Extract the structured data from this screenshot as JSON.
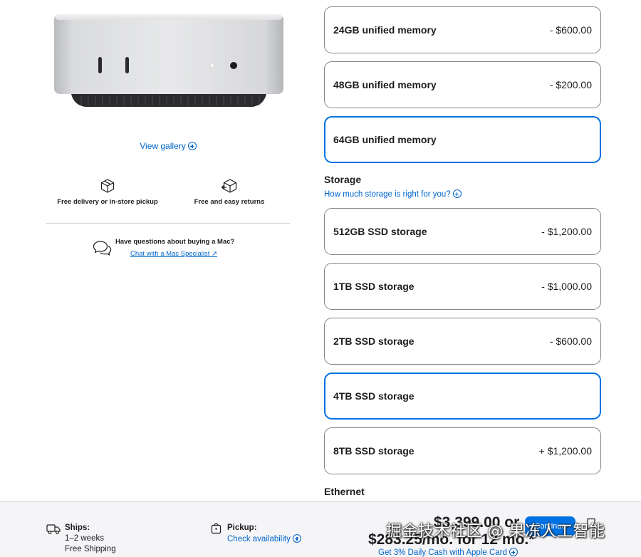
{
  "gallery": {
    "view_label": "View gallery"
  },
  "perks": {
    "delivery_label": "Free delivery or in-store pickup",
    "returns_label": "Free and easy returns"
  },
  "help": {
    "question": "Have questions about buying a Mac?",
    "link_label": "Chat with a Mac Specialist ↗"
  },
  "memory": {
    "options": [
      {
        "label": "24GB unified memory",
        "price": "- $600.00",
        "selected": false
      },
      {
        "label": "48GB unified memory",
        "price": "- $200.00",
        "selected": false
      },
      {
        "label": "64GB unified memory",
        "price": "",
        "selected": true
      }
    ]
  },
  "storage": {
    "title": "Storage",
    "help_link": "How much storage is right for you?",
    "options": [
      {
        "label": "512GB SSD storage",
        "price": "- $1,200.00",
        "selected": false
      },
      {
        "label": "1TB SSD storage",
        "price": "- $1,000.00",
        "selected": false
      },
      {
        "label": "2TB SSD storage",
        "price": "- $600.00",
        "selected": false
      },
      {
        "label": "4TB SSD storage",
        "price": "",
        "selected": true
      },
      {
        "label": "8TB SSD storage",
        "price": "+ $1,200.00",
        "selected": false
      }
    ]
  },
  "ethernet": {
    "title": "Ethernet"
  },
  "bottom_bar": {
    "ships_title": "Ships:",
    "ships_time": "1–2 weeks",
    "ships_shipping": "Free Shipping",
    "pickup_title": "Pickup:",
    "pickup_link": "Check availability",
    "price": "$3,399.00 or",
    "monthly": "$283.25/mo. for 12 mo.*",
    "apple_card": "Get 3% Daily Cash with Apple Card",
    "continue_label": "Continue"
  },
  "watermark": "掘金技术社区 @ 果冻人工智能",
  "colors": {
    "accent": "#0071e3",
    "link": "#0066cc",
    "text": "#1d1d1f",
    "bar_bg": "#f5f5f7"
  }
}
